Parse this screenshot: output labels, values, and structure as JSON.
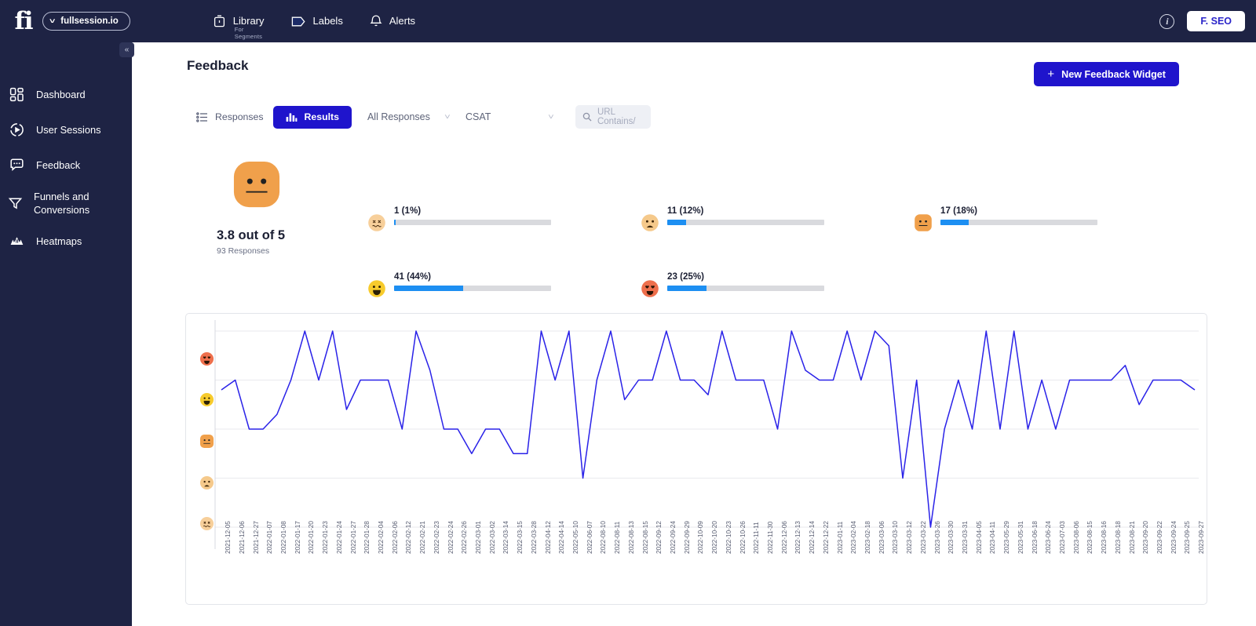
{
  "topbar": {
    "logo_text": "fi",
    "org_name": "fullsession.io",
    "org_chevron_icon": "chevron-down-icon",
    "nav": [
      {
        "label": "Library",
        "sublabel": "For Segments",
        "icon": "library-icon"
      },
      {
        "label": "Labels",
        "sublabel": "",
        "icon": "label-tag-icon"
      },
      {
        "label": "Alerts",
        "sublabel": "",
        "icon": "bell-icon"
      }
    ],
    "info_icon": "info-icon",
    "account_label": "F. SEO"
  },
  "sidebar": {
    "collapse_icon": "chevron-double-left-icon",
    "items": [
      {
        "label": "Dashboard",
        "icon": "dashboard-grid-icon"
      },
      {
        "label": "User Sessions",
        "icon": "play-circle-icon"
      },
      {
        "label": "Feedback",
        "icon": "chat-bubble-icon"
      },
      {
        "label": "Funnels and Conversions",
        "icon": "funnel-icon"
      },
      {
        "label": "Heatmaps",
        "icon": "heatmap-mountain-icon"
      }
    ]
  },
  "page": {
    "title": "Feedback",
    "new_widget_button": "New Feedback Widget",
    "new_widget_icon": "plus-icon"
  },
  "toolbar": {
    "responses_tab": "Responses",
    "responses_icon": "list-icon",
    "results_tab": "Results",
    "results_icon": "bar-chart-icon",
    "responses_filter_value": "All Responses",
    "metric_filter_value": "CSAT",
    "chevron_icon": "chevron-down-icon",
    "search_icon": "search-icon",
    "search_placeholder": "URL Contains/",
    "search_value": ""
  },
  "summary": {
    "big_emoji": "neutral-face-emoji",
    "score_text": "3.8 out of 5",
    "responses_text": "93 Responses",
    "breakdown": [
      {
        "emoji": "dizzy-face-emoji",
        "label": "1 (1%)",
        "count": 1,
        "percent": 1,
        "color": "#1d8ff2"
      },
      {
        "emoji": "sad-face-emoji",
        "label": "11 (12%)",
        "count": 11,
        "percent": 12,
        "color": "#1d8ff2"
      },
      {
        "emoji": "neutral-face-emoji",
        "label": "17 (18%)",
        "count": 17,
        "percent": 18,
        "color": "#1d8ff2"
      },
      {
        "emoji": "happy-face-emoji",
        "label": "41 (44%)",
        "count": 41,
        "percent": 44,
        "color": "#1d8ff2"
      },
      {
        "emoji": "heart-eyes-emoji",
        "label": "23 (25%)",
        "count": 23,
        "percent": 25,
        "color": "#1d8ff2"
      }
    ]
  },
  "chart_data": {
    "type": "line",
    "title": "",
    "xlabel": "",
    "ylabel": "",
    "ylim": [
      1,
      5
    ],
    "grid": true,
    "legend": false,
    "line_color": "#2a22e8",
    "ytick_labels": [
      "heart-eyes-emoji",
      "happy-face-emoji",
      "neutral-face-emoji",
      "sad-face-emoji",
      "dizzy-face-emoji"
    ],
    "ytick_values": [
      5,
      4,
      3,
      2,
      1
    ],
    "categories": [
      "2021-12-05",
      "2021-12-06",
      "2021-12-27",
      "2022-01-07",
      "2022-01-08",
      "2022-01-17",
      "2022-01-20",
      "2022-01-23",
      "2022-01-24",
      "2022-01-27",
      "2022-01-28",
      "2022-02-04",
      "2022-02-06",
      "2022-02-12",
      "2022-02-21",
      "2022-02-23",
      "2022-02-24",
      "2022-02-26",
      "2022-03-01",
      "2022-03-02",
      "2022-03-14",
      "2022-03-15",
      "2022-03-28",
      "2022-04-12",
      "2022-04-14",
      "2022-05-10",
      "2022-06-07",
      "2022-08-10",
      "2022-08-11",
      "2022-08-13",
      "2022-08-15",
      "2022-09-12",
      "2022-09-24",
      "2022-09-29",
      "2022-10-09",
      "2022-10-20",
      "2022-10-23",
      "2022-10-26",
      "2022-11-11",
      "2022-11-30",
      "2022-12-06",
      "2022-12-13",
      "2022-12-14",
      "2022-12-22",
      "2023-01-11",
      "2023-02-04",
      "2023-02-18",
      "2023-03-06",
      "2023-03-10",
      "2023-03-12",
      "2023-03-22",
      "2023-03-26",
      "2023-03-30",
      "2023-03-31",
      "2023-04-05",
      "2023-04-11",
      "2023-05-29",
      "2023-05-31",
      "2023-06-18",
      "2023-06-24",
      "2023-07-03",
      "2023-08-06",
      "2023-08-15",
      "2023-08-16",
      "2023-08-18",
      "2023-08-21",
      "2023-09-20",
      "2023-09-22",
      "2023-09-24",
      "2023-09-25",
      "2023-09-27"
    ],
    "values": [
      3.8,
      4.0,
      3.0,
      3.0,
      3.3,
      4.0,
      5.0,
      4.0,
      5.0,
      3.4,
      4.0,
      4.0,
      4.0,
      3.0,
      5.0,
      4.2,
      3.0,
      3.0,
      2.5,
      3.0,
      3.0,
      2.5,
      2.5,
      5.0,
      4.0,
      5.0,
      2.0,
      4.0,
      5.0,
      3.6,
      4.0,
      4.0,
      5.0,
      4.0,
      4.0,
      3.7,
      5.0,
      4.0,
      4.0,
      4.0,
      3.0,
      5.0,
      4.2,
      4.0,
      4.0,
      5.0,
      4.0,
      5.0,
      4.7,
      2.0,
      4.0,
      1.0,
      3.0,
      4.0,
      3.0,
      5.0,
      3.0,
      5.0,
      3.0,
      4.0,
      3.0,
      4.0,
      4.0,
      4.0,
      4.0,
      4.3,
      3.5,
      4.0,
      4.0,
      4.0,
      3.8
    ]
  }
}
